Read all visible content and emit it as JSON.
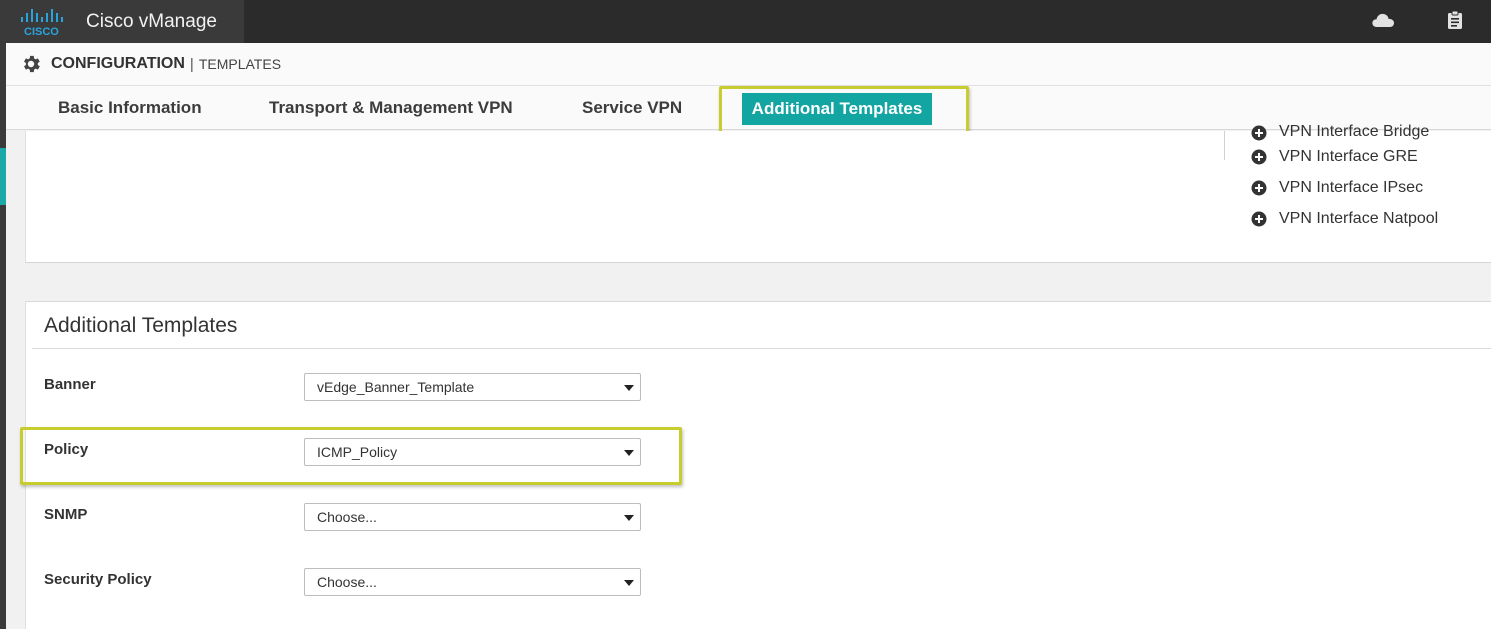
{
  "app": {
    "title": "Cisco vManage",
    "logo_text": "CISCO",
    "brand_color": "#12a5a2",
    "highlight_color": "#c8cd2f"
  },
  "topbar": {
    "icons": [
      "cloud-icon",
      "clipboard-icon"
    ]
  },
  "header": {
    "section": "CONFIGURATION",
    "separator": "|",
    "subsection": "TEMPLATES",
    "icon": "gear-icon"
  },
  "tabs": [
    {
      "label": "Basic Information",
      "active": false
    },
    {
      "label": "Transport & Management VPN",
      "active": false
    },
    {
      "label": "Service VPN",
      "active": false
    },
    {
      "label": "Additional Templates",
      "active": true
    }
  ],
  "vpn_templates": {
    "items": [
      {
        "label": "VPN Interface Bridge"
      },
      {
        "label": "VPN Interface GRE"
      },
      {
        "label": "VPN Interface IPsec"
      },
      {
        "label": "VPN Interface Natpool"
      }
    ],
    "icon": "plus-circle-icon"
  },
  "additional_templates": {
    "title": "Additional Templates",
    "rows": [
      {
        "label": "Banner",
        "value": "vEdge_Banner_Template"
      },
      {
        "label": "Policy",
        "value": "ICMP_Policy"
      },
      {
        "label": "SNMP",
        "value": "Choose..."
      },
      {
        "label": "Security Policy",
        "value": "Choose..."
      }
    ]
  }
}
